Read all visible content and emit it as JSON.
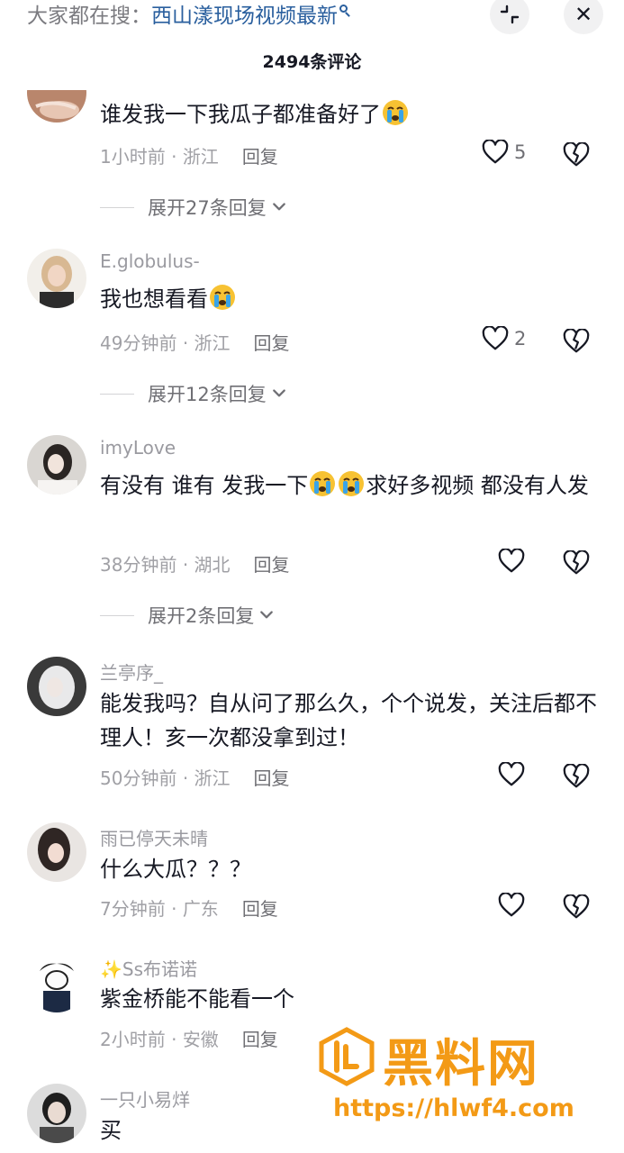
{
  "header": {
    "search_prefix": "大家都在搜：",
    "search_term": "西山漾现场视频最新",
    "comment_count": "2494条评论"
  },
  "comments": [
    {
      "username": "",
      "content": "谁发我一下我瓜子都准备好了",
      "emojis": [
        "crying-face"
      ],
      "time": "1小时前",
      "location": "浙江",
      "reply_label": "回复",
      "likes": "5",
      "expand_label": "展开27条回复"
    },
    {
      "username": "E.globulus-",
      "content": "我也想看看",
      "emojis": [
        "crying-face"
      ],
      "time": "49分钟前",
      "location": "浙江",
      "reply_label": "回复",
      "likes": "2",
      "expand_label": "展开12条回复"
    },
    {
      "username": "imyLove",
      "content_part1": "有没有 谁有 发我一下",
      "content_part2": "求好多视频 都没有人发",
      "emojis": [
        "crying-face",
        "crying-face"
      ],
      "time": "38分钟前",
      "location": "湖北",
      "reply_label": "回复",
      "likes": "",
      "expand_label": "展开2条回复"
    },
    {
      "username": "兰亭序_",
      "content": "能发我吗？自从问了那么久，个个说发，关注后都不理人！亥一次都没拿到过！",
      "time": "50分钟前",
      "location": "浙江",
      "reply_label": "回复",
      "likes": ""
    },
    {
      "username": "雨已停天未晴",
      "content": "什么大瓜？？？",
      "time": "7分钟前",
      "location": "广东",
      "reply_label": "回复",
      "likes": ""
    },
    {
      "username": "Ss布诺诺",
      "content": "紫金桥能不能看一个",
      "time": "2小时前",
      "location": "安徽",
      "reply_label": "回复",
      "likes": ""
    },
    {
      "username": "一只小易烊",
      "content": "买"
    }
  ],
  "meta_separator": "·",
  "watermark": {
    "text": "黑料网",
    "url": "https://hlwf4.com"
  },
  "colors": {
    "accent_link": "#2a5f9e",
    "watermark": "#f39a16",
    "text_primary": "#161823",
    "text_secondary": "#9a9aa0"
  }
}
